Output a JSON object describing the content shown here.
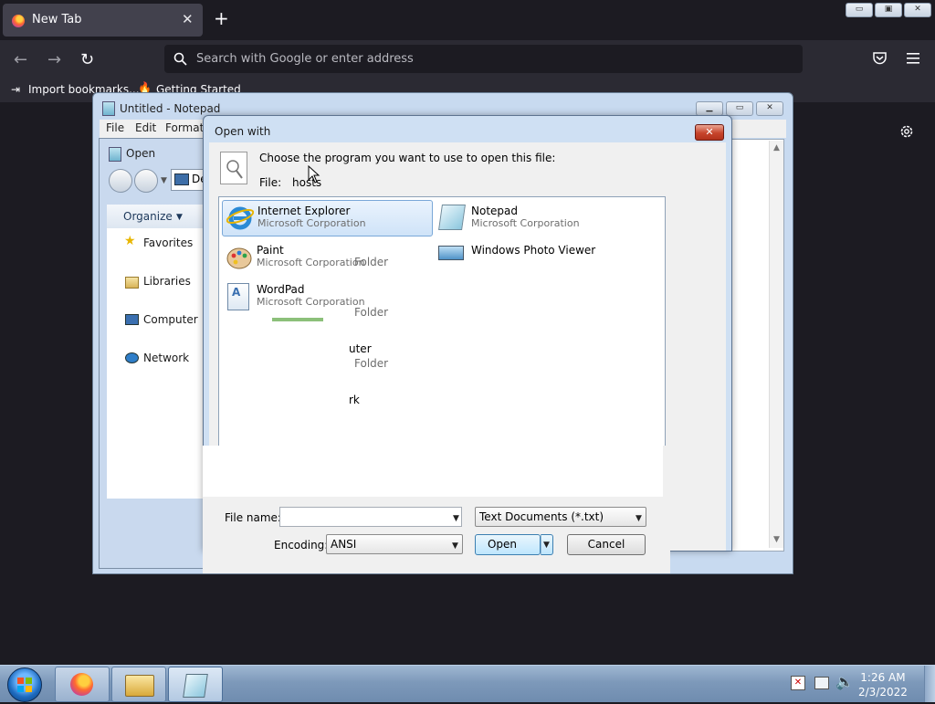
{
  "firefox": {
    "tab_title": "New Tab",
    "tab_close": "✕",
    "new_tab": "+",
    "url_placeholder": "Search with Google or enter address",
    "bookmarks": [
      "Import bookmarks...",
      "Getting Started"
    ],
    "window_buttons": [
      "▭",
      "▣",
      "✕"
    ],
    "icons": [
      "back-arrow-icon",
      "forward-arrow-icon",
      "reload-icon",
      "search-icon",
      "pocket-icon",
      "hamburger-menu-icon",
      "settings-gear-icon"
    ]
  },
  "notepad": {
    "title": "Untitled - Notepad",
    "menu": [
      "File",
      "Edit",
      "Format"
    ],
    "window_buttons": [
      "▁",
      "▭",
      "✕"
    ]
  },
  "open_dialog": {
    "title": "Open",
    "location_fragment": "De",
    "organize": "Organize",
    "nav": [
      "Favorites",
      "Libraries",
      "Computer",
      "Network"
    ],
    "partial_folders": [
      {
        "label": "Folder"
      },
      {
        "label": "Folder"
      },
      {
        "label": "uter"
      },
      {
        "label": "Folder"
      },
      {
        "label": "rk"
      }
    ],
    "file_name_label": "File name:",
    "file_name_value": "",
    "file_type": "Text Documents (*.txt)",
    "encoding_label": "Encoding:",
    "encoding_value": "ANSI",
    "open_button": "Open",
    "cancel_button": "Cancel"
  },
  "open_with": {
    "title": "Open with",
    "close": "✕",
    "prompt": "Choose the program you want to use to open this file:",
    "file_label": "File:",
    "file_value": "hosts",
    "programs": [
      {
        "name": "Internet Explorer",
        "publisher": "Microsoft Corporation",
        "selected": true
      },
      {
        "name": "Notepad",
        "publisher": "Microsoft Corporation",
        "selected": false
      },
      {
        "name": "Paint",
        "publisher": "Microsoft Corporation",
        "selected": false
      },
      {
        "name": "Windows Photo Viewer",
        "publisher": "",
        "selected": false
      },
      {
        "name": "WordPad",
        "publisher": "Microsoft Corporation",
        "selected": false
      }
    ]
  },
  "taskbar": {
    "time": "1:26 AM",
    "date": "2/3/2022",
    "apps": [
      "firefox-icon",
      "file-explorer-icon",
      "notepad-icon"
    ],
    "tray_icons": [
      "action-center-flag-icon",
      "network-icon",
      "volume-icon"
    ]
  }
}
